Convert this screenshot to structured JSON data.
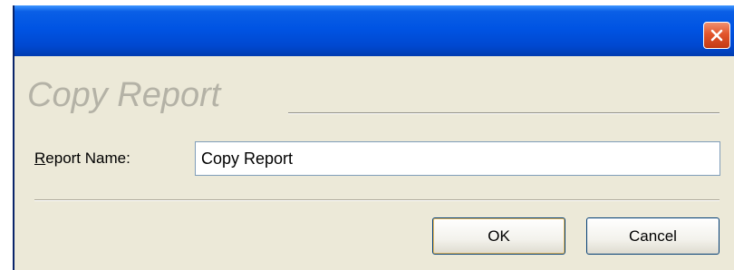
{
  "window": {
    "title": "",
    "close_icon": "close-icon"
  },
  "dialog": {
    "heading": "Copy Report",
    "field_label_accel": "R",
    "field_label_rest": "eport Name:",
    "report_name_value": "Copy Report"
  },
  "buttons": {
    "ok_label": "OK",
    "cancel_label": "Cancel"
  },
  "colors": {
    "titlebar": "#0054e3",
    "dialog_bg": "#ece9d8",
    "close_button": "#e2552b",
    "heading_text": "#b4b2a6"
  }
}
